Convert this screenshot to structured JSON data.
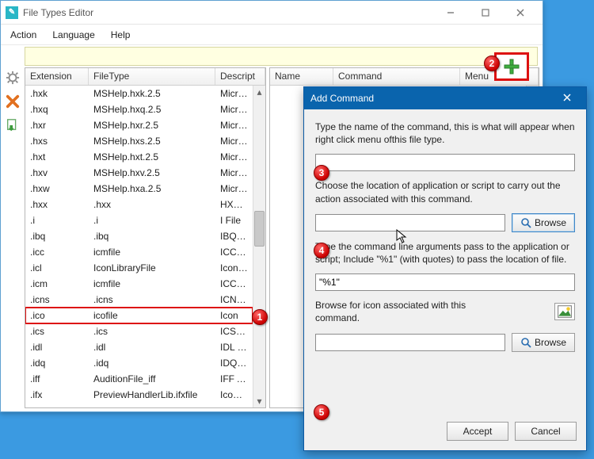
{
  "window": {
    "title": "File Types Editor",
    "menu": [
      "Action",
      "Language",
      "Help"
    ]
  },
  "left_list": {
    "columns": [
      "Extension",
      "FileType",
      "Descript"
    ],
    "selected_index": 14,
    "rows": [
      {
        "ext": ".hxk",
        "type": "MSHelp.hxk.2.5",
        "desc": "Microso"
      },
      {
        "ext": ".hxq",
        "type": "MSHelp.hxq.2.5",
        "desc": "Microso"
      },
      {
        "ext": ".hxr",
        "type": "MSHelp.hxr.2.5",
        "desc": "Microso"
      },
      {
        "ext": ".hxs",
        "type": "MSHelp.hxs.2.5",
        "desc": "Microso"
      },
      {
        "ext": ".hxt",
        "type": "MSHelp.hxt.2.5",
        "desc": "Microso"
      },
      {
        "ext": ".hxv",
        "type": "MSHelp.hxv.2.5",
        "desc": "Microso"
      },
      {
        "ext": ".hxw",
        "type": "MSHelp.hxa.2.5",
        "desc": "Microso"
      },
      {
        "ext": ".hxx",
        "type": ".hxx",
        "desc": "HXX File"
      },
      {
        "ext": ".i",
        "type": ".i",
        "desc": "I File"
      },
      {
        "ext": ".ibq",
        "type": ".ibq",
        "desc": "IBQ File"
      },
      {
        "ext": ".icc",
        "type": "icmfile",
        "desc": "ICC Prof"
      },
      {
        "ext": ".icl",
        "type": "IconLibraryFile",
        "desc": "Icon Libr"
      },
      {
        "ext": ".icm",
        "type": "icmfile",
        "desc": "ICC Prof"
      },
      {
        "ext": ".icns",
        "type": ".icns",
        "desc": "ICNS Fil"
      },
      {
        "ext": ".ico",
        "type": "icofile",
        "desc": "Icon"
      },
      {
        "ext": ".ics",
        "type": ".ics",
        "desc": "ICS File"
      },
      {
        "ext": ".idl",
        "type": ".idl",
        "desc": "IDL File"
      },
      {
        "ext": ".idq",
        "type": ".idq",
        "desc": "IDQ File"
      },
      {
        "ext": ".iff",
        "type": "AuditionFile_iff",
        "desc": "IFF Audi"
      },
      {
        "ext": ".ifx",
        "type": "PreviewHandlerLib.ifxfile",
        "desc": "IcoFX I"
      }
    ]
  },
  "right_list": {
    "columns": [
      "Name",
      "Command",
      "Menu"
    ]
  },
  "dialog": {
    "title": "Add Command",
    "p1": "Type the name of the command,  this is what will appear when right click menu ofthis file type.",
    "p2": "Choose the location of application or script to carry out the action associated with this command.",
    "p3": "Type the command line arguments pass to the application or script; Include \"%1\" (with quotes) to pass the location of file.",
    "p4": "Browse for icon associated with this command.",
    "name_value": "",
    "location_value": "",
    "args_value": "\"%1\"",
    "icon_value": "",
    "browse_label": "Browse",
    "accept_label": "Accept",
    "cancel_label": "Cancel"
  },
  "badges": [
    "1",
    "2",
    "3",
    "4",
    "5"
  ]
}
